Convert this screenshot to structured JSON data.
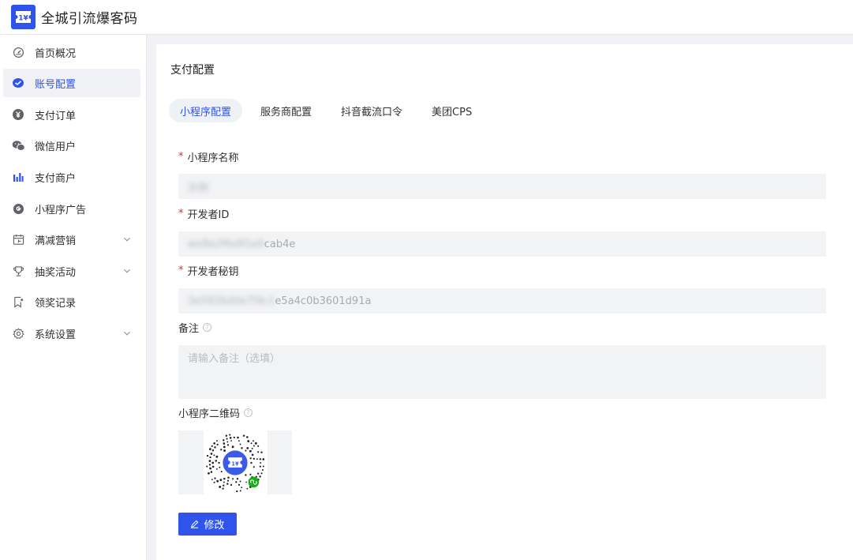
{
  "header": {
    "title": "全城引流爆客码",
    "logo_icon": "ticket-icon",
    "brand_color": "#2f54eb"
  },
  "sidebar": {
    "items": [
      {
        "label": "首页概况",
        "icon": "dashboard-icon",
        "active": false,
        "expandable": false
      },
      {
        "label": "账号配置",
        "icon": "check-badge-icon",
        "active": true,
        "expandable": false
      },
      {
        "label": "支付订单",
        "icon": "yuan-icon",
        "active": false,
        "expandable": false
      },
      {
        "label": "微信用户",
        "icon": "wechat-icon",
        "active": false,
        "expandable": false
      },
      {
        "label": "支付商户",
        "icon": "bar-chart-icon",
        "active": false,
        "expandable": false
      },
      {
        "label": "小程序广告",
        "icon": "google-icon",
        "active": false,
        "expandable": false
      },
      {
        "label": "满减营销",
        "icon": "calendar-icon",
        "active": false,
        "expandable": true
      },
      {
        "label": "抽奖活动",
        "icon": "trophy-icon",
        "active": false,
        "expandable": true
      },
      {
        "label": "领奖记录",
        "icon": "bookmark-icon",
        "active": false,
        "expandable": false
      },
      {
        "label": "系统设置",
        "icon": "gear-icon",
        "active": false,
        "expandable": true
      }
    ]
  },
  "main": {
    "section_title": "支付配置",
    "tabs": [
      {
        "label": "小程序配置",
        "active": true
      },
      {
        "label": "服务商配置",
        "active": false
      },
      {
        "label": "抖音截流口令",
        "active": false
      },
      {
        "label": "美团CPS",
        "active": false
      }
    ],
    "form": {
      "name_label": "小程序名称",
      "name_value_blurred": "示例",
      "appid_label": "开发者ID",
      "appid_value_blurred": "wx8a2f6d91e0",
      "appid_value_visible": "cab4e",
      "secret_label": "开发者秘钥",
      "secret_value_blurred": "3e5926d0e7f4c1",
      "secret_value_visible": "e5a4c0b3601d91a",
      "remark_label": "备注",
      "remark_placeholder": "请输入备注（选填）",
      "remark_help": "?",
      "qrcode_label": "小程序二维码",
      "qrcode_help": "?",
      "required_mark": "*"
    },
    "edit_button": {
      "label": "修改",
      "icon": "pencil-icon"
    }
  }
}
